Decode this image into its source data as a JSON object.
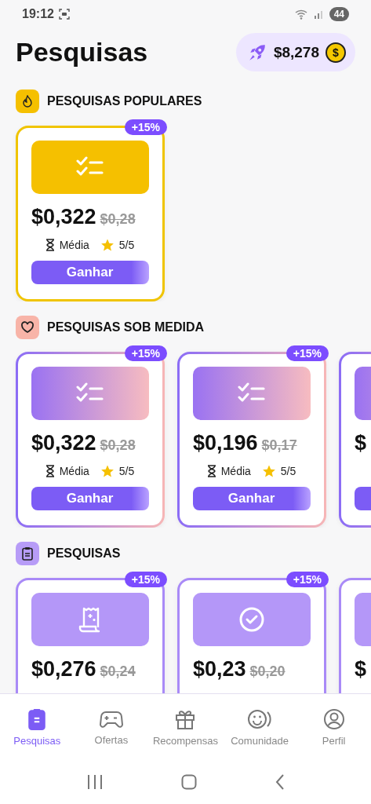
{
  "status_bar": {
    "time": "19:12",
    "battery": "44"
  },
  "header": {
    "title": "Pesquisas",
    "balance": "$8,278",
    "coin_symbol": "$"
  },
  "sections": [
    {
      "title": "PESQUISAS POPULARES",
      "kind": "popular",
      "color": "#f5c000",
      "cards": [
        {
          "badge": "+15%",
          "kind": "checklist",
          "price": "$0,322",
          "old_price": "$0,28",
          "duration": "Média",
          "rating": "5/5",
          "button": "Ganhar"
        }
      ]
    },
    {
      "title": "PESQUISAS SOB MEDIDA",
      "kind": "tailored",
      "color": "#f8b4a8",
      "cards": [
        {
          "badge": "+15%",
          "kind": "checklist",
          "price": "$0,322",
          "old_price": "$0,28",
          "duration": "Média",
          "rating": "5/5",
          "button": "Ganhar"
        },
        {
          "badge": "+15%",
          "kind": "checklist",
          "price": "$0,196",
          "old_price": "$0,17",
          "duration": "Média",
          "rating": "5/5",
          "button": "Ganhar"
        },
        {
          "kind": "plain",
          "price": "$"
        }
      ]
    },
    {
      "title": "PESQUISAS",
      "kind": "standard",
      "color": "#b79cf7",
      "cards": [
        {
          "badge": "+15%",
          "kind": "receipt",
          "price": "$0,276",
          "old_price": "$0,24"
        },
        {
          "badge": "+15%",
          "kind": "confirmation",
          "price": "$0,23",
          "old_price": "$0,20"
        },
        {
          "kind": "plain",
          "price": "$"
        }
      ]
    }
  ],
  "nav": [
    {
      "label": "Pesquisas",
      "selected": true
    },
    {
      "label": "Ofertas",
      "selected": false
    },
    {
      "label": "Recompensas",
      "selected": false
    },
    {
      "label": "Comunidade",
      "selected": false
    },
    {
      "label": "Perfil",
      "selected": false
    }
  ]
}
